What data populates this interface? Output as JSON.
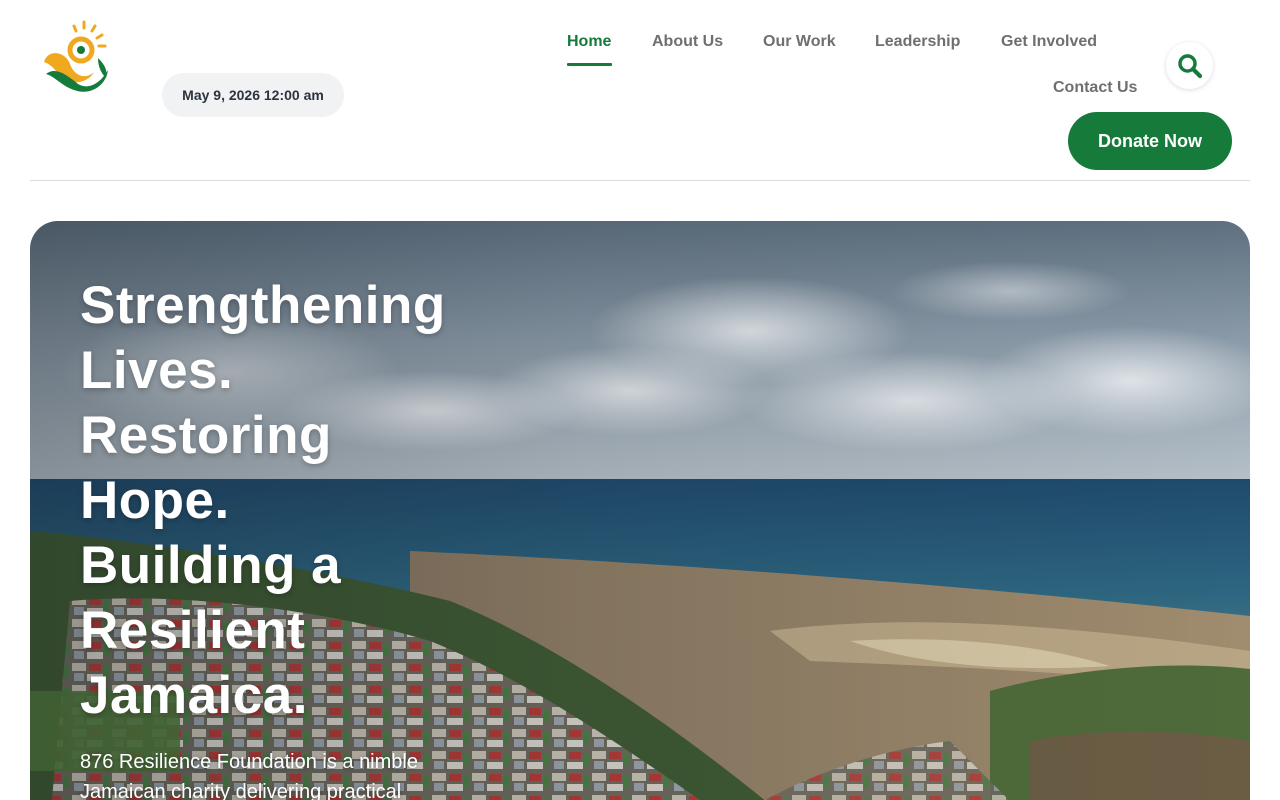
{
  "header": {
    "date": "May 9, 2026 12:00 am",
    "nav": [
      {
        "label": "Home",
        "active": true
      },
      {
        "label": "About Us",
        "active": false
      },
      {
        "label": "Our Work",
        "active": false
      },
      {
        "label": "Leadership",
        "active": false
      },
      {
        "label": "Get Involved",
        "active": false
      },
      {
        "label": "Contact Us",
        "active": false
      }
    ],
    "search_icon": "search-icon",
    "donate_label": "Donate Now"
  },
  "hero": {
    "title_lines": [
      "Strengthening",
      "Lives.",
      "Restoring",
      "Hope.",
      "Building a",
      "Resilient",
      "Jamaica."
    ],
    "description": "876 Resilience Foundation is a nimble Jamaican charity delivering practical"
  },
  "colors": {
    "brand_green": "#157a3a",
    "brand_gold": "#f0a81e",
    "nav_text": "#6f6f6f"
  }
}
